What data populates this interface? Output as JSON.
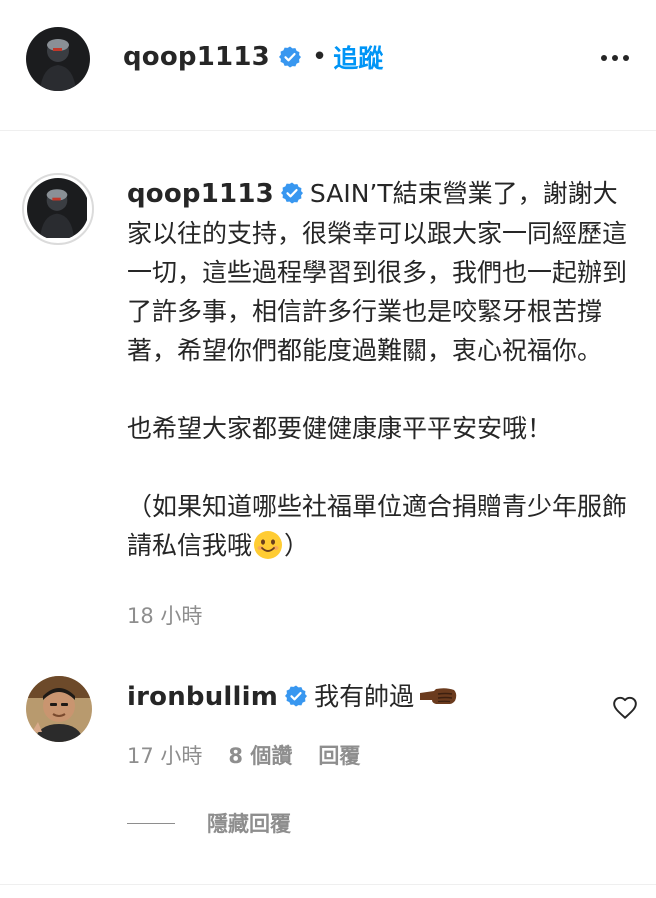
{
  "header": {
    "username": "qoop1113",
    "separator": "•",
    "follow_label": "追蹤",
    "more_icon": "more-horizontal-icon",
    "verified_icon": "verified-badge-icon"
  },
  "caption": {
    "username": "qoop1113",
    "text_line1": "SAIN’T結束營業了，謝謝大家以往的支持，很榮幸可以跟大家一同經歷這一切，這些過程學習到很多，我們也一起辦到了許多事，相信許多行業也是咬緊牙根苦撐著，希望你們都能度過難關，衷心祝福你。",
    "text_line2": "也希望大家都要健健康康平平安安哦！",
    "text_line3_before": "（如果知道哪些社福單位適合捐贈青少年服飾請私信我哦",
    "text_line3_after": "）",
    "emoji": "smiling-face-emoji",
    "time": "18 小時"
  },
  "comment": {
    "username": "ironbullim",
    "text": "我有帥過",
    "emoji": "fist-bump-emoji",
    "time": "17 小時",
    "likes": "8 個讚",
    "reply_label": "回覆",
    "like_icon": "heart-outline-icon"
  },
  "hide_replies_label": "隱藏回覆",
  "colors": {
    "text": "#262626",
    "secondary": "#8e8e8e",
    "link": "#0095f6",
    "verified": "#3897f0",
    "divider": "#efefef"
  }
}
